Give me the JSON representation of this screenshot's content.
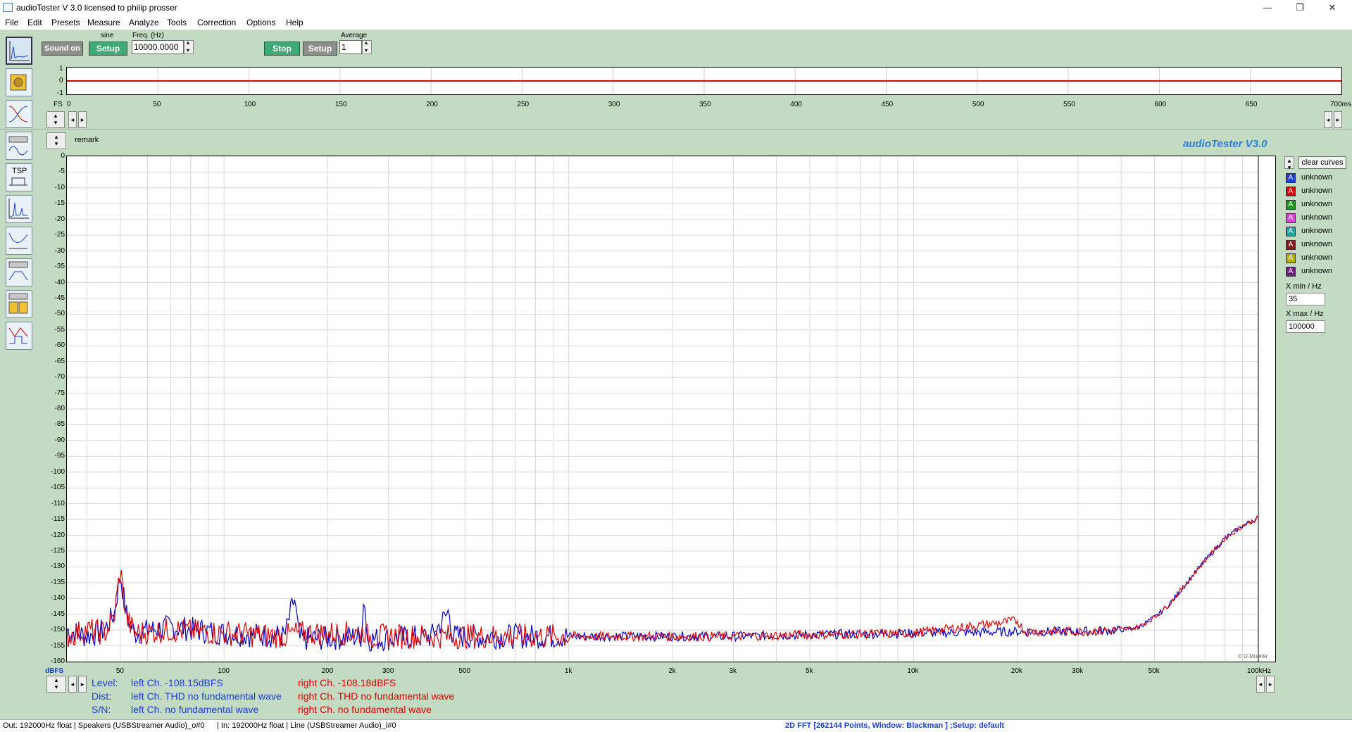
{
  "titlebar": {
    "title": "audioTester  V 3.0   licensed to philip prosser",
    "minimize": "—",
    "restore": "❐",
    "close": "✕"
  },
  "menu": [
    "File",
    "Edit",
    "Presets",
    "Measure",
    "Analyze",
    "Tools",
    "Correction",
    "Options",
    "Help"
  ],
  "toolbar": {
    "sound_on": "Sound on",
    "signal_type": "sine",
    "setup1": "Setup",
    "freq_label": "Freq. (Hz)",
    "freq_value": "10000.0000",
    "stop": "Stop",
    "setup2": "Setup",
    "average_label": "Average",
    "average_value": "1"
  },
  "left_tools": [
    {
      "icon": "spectrum-icon"
    },
    {
      "icon": "speaker-measure-icon"
    },
    {
      "icon": "filter-response-icon"
    },
    {
      "icon": "impulse-icon"
    },
    {
      "icon": "tsp-icon",
      "label": "TSP"
    },
    {
      "icon": "fft-icon"
    },
    {
      "icon": "impedance-icon"
    },
    {
      "icon": "crossover-icon"
    },
    {
      "icon": "multi-speaker-icon"
    },
    {
      "icon": "step-response-icon"
    }
  ],
  "time_plot": {
    "y_ticks": [
      "1",
      "0",
      "-1"
    ],
    "fs_label": "FS",
    "x_ticks": [
      "0",
      "50",
      "100",
      "150",
      "200",
      "250",
      "300",
      "350",
      "400",
      "450",
      "500",
      "550",
      "600",
      "650",
      "700ms"
    ],
    "trace_color": "#e00000"
  },
  "remark": "remark",
  "brand": "audioTester  V3.0",
  "copyright": "© U.Mueller",
  "chart_data": {
    "type": "line",
    "title": "",
    "xlabel": "Hz",
    "ylabel": "dBFS",
    "xscale": "log",
    "xlim": [
      35,
      100000
    ],
    "ylim": [
      -160,
      0
    ],
    "grid": true,
    "y_ticks": [
      "0",
      "-5",
      "-10",
      "-15",
      "-20",
      "-25",
      "-30",
      "-35",
      "-40",
      "-45",
      "-50",
      "-55",
      "-60",
      "-65",
      "-70",
      "-75",
      "-80",
      "-85",
      "-90",
      "-95",
      "-100",
      "-105",
      "-110",
      "-115",
      "-120",
      "-125",
      "-130",
      "-135",
      "-140",
      "-145",
      "-150",
      "-155",
      "-160"
    ],
    "x_ticks": [
      {
        "v": 50,
        "t": "50"
      },
      {
        "v": 100,
        "t": "100"
      },
      {
        "v": 200,
        "t": "200"
      },
      {
        "v": 300,
        "t": "300"
      },
      {
        "v": 500,
        "t": "500"
      },
      {
        "v": 1000,
        "t": "1k"
      },
      {
        "v": 2000,
        "t": "2k"
      },
      {
        "v": 3000,
        "t": "3k"
      },
      {
        "v": 5000,
        "t": "5k"
      },
      {
        "v": 10000,
        "t": "10k"
      },
      {
        "v": 20000,
        "t": "20k"
      },
      {
        "v": 30000,
        "t": "30k"
      },
      {
        "v": 50000,
        "t": "50k"
      },
      {
        "v": 100000,
        "t": "100kHz"
      }
    ],
    "series": [
      {
        "color": "#0000cc",
        "points": [
          [
            35,
            -150
          ],
          [
            40,
            -152
          ],
          [
            45,
            -150
          ],
          [
            48,
            -145
          ],
          [
            50,
            -132
          ],
          [
            52,
            -145
          ],
          [
            55,
            -151
          ],
          [
            70,
            -149
          ],
          [
            100,
            -151
          ],
          [
            150,
            -152
          ],
          [
            160,
            -140
          ],
          [
            165,
            -153
          ],
          [
            250,
            -152
          ],
          [
            255,
            -138
          ],
          [
            260,
            -153
          ],
          [
            400,
            -152
          ],
          [
            450,
            -144
          ],
          [
            460,
            -152
          ],
          [
            1000,
            -152
          ],
          [
            3000,
            -152
          ],
          [
            5000,
            -151.5
          ],
          [
            10000,
            -151
          ],
          [
            20000,
            -150.5
          ],
          [
            30000,
            -150.5
          ],
          [
            40000,
            -150
          ],
          [
            45000,
            -149
          ],
          [
            50000,
            -146
          ],
          [
            55000,
            -142
          ],
          [
            60000,
            -137
          ],
          [
            70000,
            -128
          ],
          [
            80000,
            -121
          ],
          [
            90000,
            -117
          ],
          [
            100000,
            -114.5
          ]
        ]
      },
      {
        "color": "#dd0000",
        "points": [
          [
            35,
            -152
          ],
          [
            40,
            -150
          ],
          [
            45,
            -151
          ],
          [
            48,
            -146
          ],
          [
            50,
            -131
          ],
          [
            52,
            -146
          ],
          [
            55,
            -151
          ],
          [
            70,
            -150
          ],
          [
            100,
            -151
          ],
          [
            150,
            -152
          ],
          [
            160,
            -151
          ],
          [
            250,
            -151
          ],
          [
            255,
            -150
          ],
          [
            260,
            -152
          ],
          [
            400,
            -152
          ],
          [
            1000,
            -152
          ],
          [
            3000,
            -152
          ],
          [
            5000,
            -151.5
          ],
          [
            10000,
            -151
          ],
          [
            20000,
            -147
          ],
          [
            21000,
            -150.5
          ],
          [
            30000,
            -150.5
          ],
          [
            40000,
            -150
          ],
          [
            45000,
            -149
          ],
          [
            50000,
            -146
          ],
          [
            55000,
            -142
          ],
          [
            60000,
            -137
          ],
          [
            70000,
            -128
          ],
          [
            80000,
            -121
          ],
          [
            90000,
            -117
          ],
          [
            100000,
            -114.5
          ]
        ]
      }
    ]
  },
  "legend": {
    "clear": "clear curves",
    "items": [
      {
        "label": "unknown",
        "color": "#1a3fd6"
      },
      {
        "label": "unknown",
        "color": "#e00000"
      },
      {
        "label": "unknown",
        "color": "#1a9a1a"
      },
      {
        "label": "unknown",
        "color": "#e040e0"
      },
      {
        "label": "unknown",
        "color": "#20a0a0"
      },
      {
        "label": "unknown",
        "color": "#8a1a1a"
      },
      {
        "label": "unknown",
        "color": "#b0b000"
      },
      {
        "label": "unknown",
        "color": "#7a1a8a"
      }
    ],
    "xmin_label": "X min / Hz",
    "xmin_value": "35",
    "xmax_label": "X max / Hz",
    "xmax_value": "100000"
  },
  "results": {
    "level_label": "Level:",
    "dist_label": "Dist:",
    "sn_label": "S/N:",
    "level_left": "left Ch. -108.15dBFS",
    "level_right": "right Ch. -108.18dBFS",
    "dist_left": "left Ch. THD no fundamental wave",
    "dist_right": "right Ch. THD no fundamental wave",
    "sn_left": "left Ch.  no fundamental wave",
    "sn_right": "right Ch.  no fundamental wave",
    "left_color": "#1a3fd6",
    "right_color": "#e00000"
  },
  "status": {
    "out": "Out: 192000Hz float  | Speakers (USBStreamer Audio)_o#0",
    "in": "| In: 192000Hz float  | Line (USBStreamer Audio)_i#0",
    "mode": "2D FFT [262144 Points, Window: Blackman ] ;Setup:  default"
  }
}
